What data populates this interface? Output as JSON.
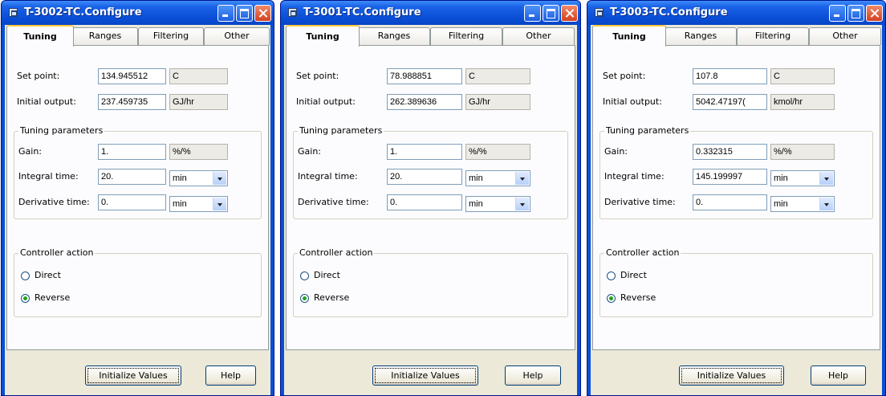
{
  "windows": [
    {
      "title": "T-3002-TC.Configure",
      "tabs": [
        "Tuning",
        "Ranges",
        "Filtering",
        "Other"
      ],
      "active_tab": "Tuning",
      "set_point": {
        "label": "Set point:",
        "value": "134.945512",
        "unit": "C"
      },
      "initial_output": {
        "label": "Initial output:",
        "value": "237.459735",
        "unit": "GJ/hr"
      },
      "tuning_group": "Tuning parameters",
      "gain": {
        "label": "Gain:",
        "value": "1.",
        "unit": "%/%"
      },
      "integral_time": {
        "label": "Integral time:",
        "value": "20.",
        "unit": "min"
      },
      "derivative_time": {
        "label": "Derivative time:",
        "value": "0.",
        "unit": "min"
      },
      "action_group": "Controller action",
      "direct_label": "Direct",
      "reverse_label": "Reverse",
      "selected_action": "Reverse",
      "init_button": "Initialize Values",
      "help_button": "Help"
    },
    {
      "title": "T-3001-TC.Configure",
      "tabs": [
        "Tuning",
        "Ranges",
        "Filtering",
        "Other"
      ],
      "active_tab": "Tuning",
      "set_point": {
        "label": "Set point:",
        "value": "78.988851",
        "unit": "C"
      },
      "initial_output": {
        "label": "Initial output:",
        "value": "262.389636",
        "unit": "GJ/hr"
      },
      "tuning_group": "Tuning parameters",
      "gain": {
        "label": "Gain:",
        "value": "1.",
        "unit": "%/%"
      },
      "integral_time": {
        "label": "Integral time:",
        "value": "20.",
        "unit": "min"
      },
      "derivative_time": {
        "label": "Derivative time:",
        "value": "0.",
        "unit": "min"
      },
      "action_group": "Controller action",
      "direct_label": "Direct",
      "reverse_label": "Reverse",
      "selected_action": "Reverse",
      "init_button": "Initialize Values",
      "help_button": "Help"
    },
    {
      "title": "T-3003-TC.Configure",
      "tabs": [
        "Tuning",
        "Ranges",
        "Filtering",
        "Other"
      ],
      "active_tab": "Tuning",
      "set_point": {
        "label": "Set point:",
        "value": "107.8",
        "unit": "C"
      },
      "initial_output": {
        "label": "Initial output:",
        "value": "5042.47197(",
        "unit": "kmol/hr"
      },
      "tuning_group": "Tuning parameters",
      "gain": {
        "label": "Gain:",
        "value": "0.332315",
        "unit": "%/%"
      },
      "integral_time": {
        "label": "Integral time:",
        "value": "145.199997",
        "unit": "min"
      },
      "derivative_time": {
        "label": "Derivative time:",
        "value": "0.",
        "unit": "min"
      },
      "action_group": "Controller action",
      "direct_label": "Direct",
      "reverse_label": "Reverse",
      "selected_action": "Reverse",
      "init_button": "Initialize Values",
      "help_button": "Help"
    }
  ],
  "icons": {
    "window": "window-icon",
    "minimize": "minimize-icon",
    "maximize": "maximize-icon",
    "close": "close-icon",
    "dropdown": "chevron-down-icon"
  },
  "colors": {
    "titlebar": "#0a4fd6",
    "client": "#ece9d8",
    "tab_highlight": "#ffc83c",
    "radio_dot": "#21a121"
  }
}
